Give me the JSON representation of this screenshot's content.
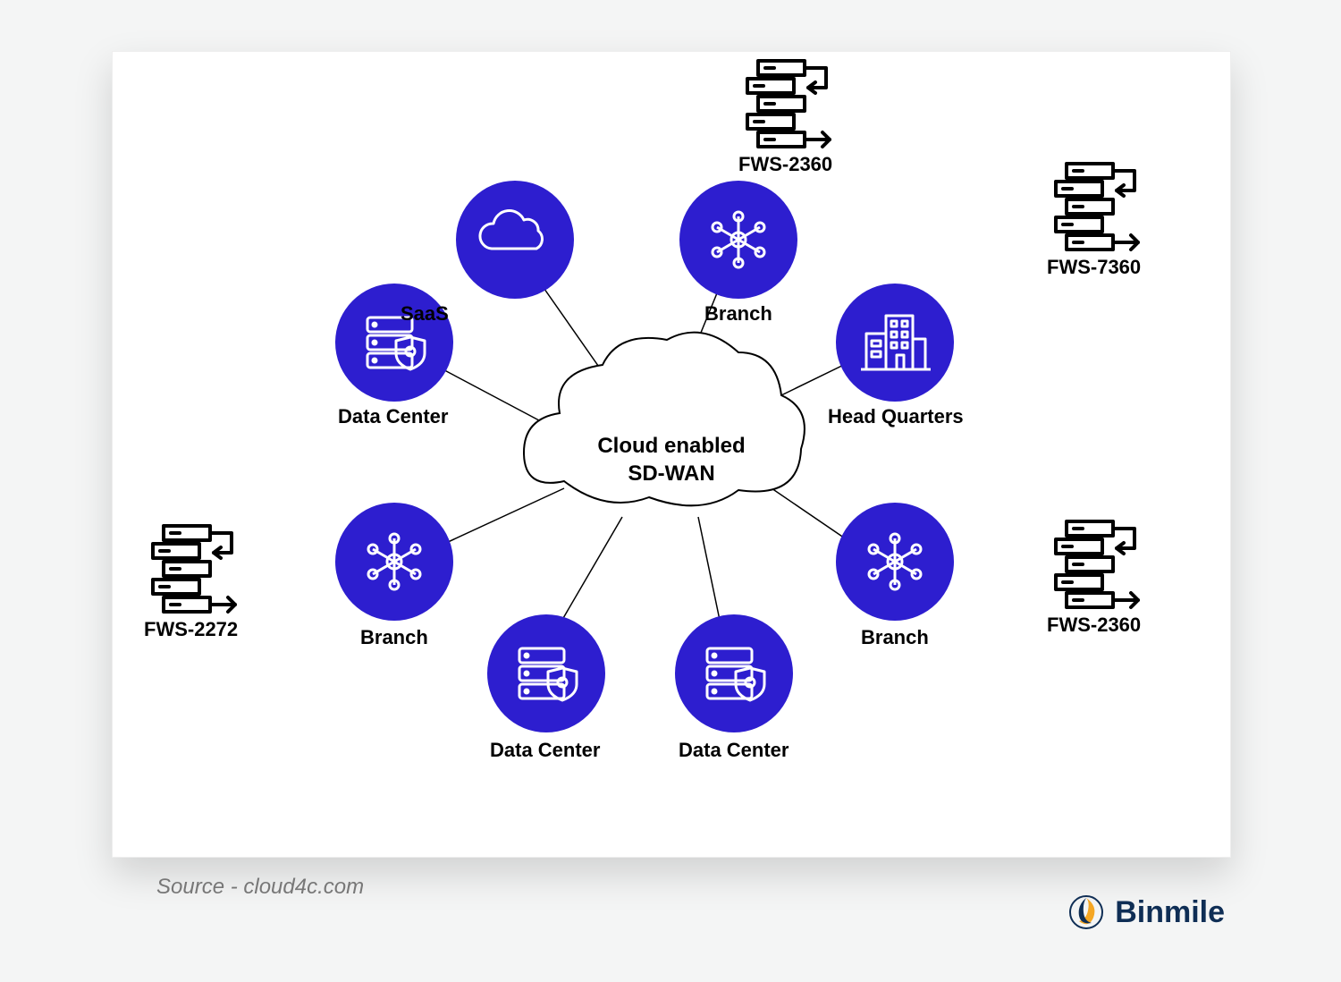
{
  "center": {
    "line1": "Cloud enabled",
    "line2": "SD-WAN"
  },
  "nodes": {
    "saas": {
      "label": "SaaS"
    },
    "branchTop": {
      "label": "Branch"
    },
    "hq": {
      "label": "Head Quarters"
    },
    "branchRight": {
      "label": "Branch"
    },
    "dcRightBot": {
      "label": "Data Center"
    },
    "dcLeftBot": {
      "label": "Data Center"
    },
    "branchLeft": {
      "label": "Branch"
    },
    "dcLeft": {
      "label": "Data Center"
    }
  },
  "fws": {
    "top": {
      "label": "FWS-2360"
    },
    "right1": {
      "label": "FWS-7360"
    },
    "right2": {
      "label": "FWS-2360"
    },
    "left": {
      "label": "FWS-2272"
    }
  },
  "source": "Source - cloud4c.com",
  "brand": "Binmile",
  "colors": {
    "nodeFill": "#2d1ecf",
    "iconStroke": "#ffffff",
    "line": "#000000"
  }
}
